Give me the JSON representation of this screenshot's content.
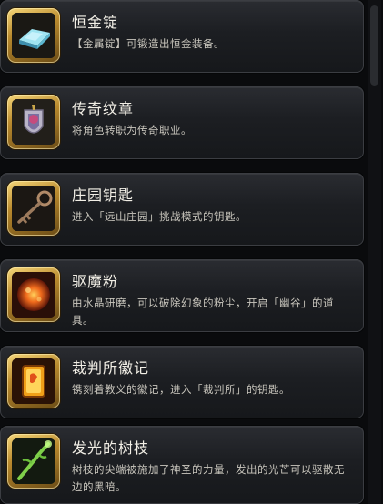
{
  "items": [
    {
      "title": "恒金锭",
      "description": "【金属锭】可锻造出恒金装备。",
      "icon": "metal-ingot-icon"
    },
    {
      "title": "传奇纹章",
      "description": "将角色转职为传奇职业。",
      "icon": "legend-crest-icon"
    },
    {
      "title": "庄园钥匙",
      "description": "进入「远山庄园」挑战模式的钥匙。",
      "icon": "manor-key-icon"
    },
    {
      "title": "驱魔粉",
      "description": "由水晶研磨，可以破除幻象的粉尘，开启「幽谷」的道具。",
      "icon": "exorcism-powder-icon"
    },
    {
      "title": "裁判所徽记",
      "description": "镌刻着教义的徽记，进入「裁判所」的钥匙。",
      "icon": "tribunal-emblem-icon"
    },
    {
      "title": "发光的树枝",
      "description": "树枝的尖端被施加了神圣的力量，发出的光芒可以驱散无边的黑暗。",
      "icon": "glowing-branch-icon"
    }
  ]
}
